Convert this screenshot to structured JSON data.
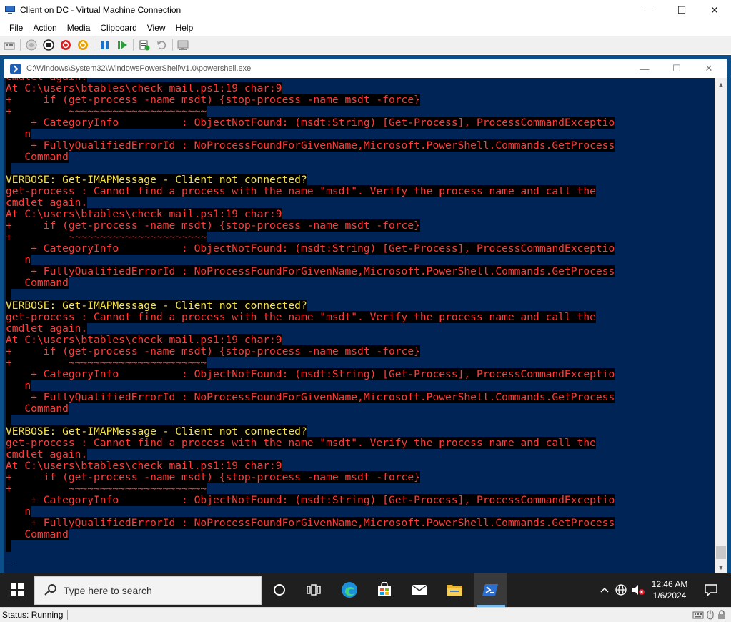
{
  "vm_window": {
    "title": "Client on DC - Virtual Machine Connection",
    "controls": {
      "minimize": "—",
      "maximize": "☐",
      "close": "✕"
    }
  },
  "menu": [
    "File",
    "Action",
    "Media",
    "Clipboard",
    "View",
    "Help"
  ],
  "toolbar": {
    "icons": [
      "ctrl-alt-del-icon",
      "start-icon",
      "turn-off-icon",
      "shut-down-icon",
      "save-icon",
      "pause-icon",
      "reset-icon",
      "checkpoint-icon",
      "revert-icon",
      "enhanced-session-icon"
    ],
    "colors": {
      "turn_off": "#d81e1e",
      "shut_down": "#e8a000",
      "pause": "#1a73c9",
      "reset": "#2e9e3a"
    }
  },
  "powershell": {
    "title": "C:\\Windows\\System32\\WindowsPowerShell\\v1.0\\powershell.exe",
    "background": "#012456",
    "lines": [
      {
        "type": "error",
        "text": "cmdlet again."
      },
      {
        "type": "error",
        "text": "At C:\\users\\btables\\check_mail.ps1:19 char:9"
      },
      {
        "type": "error",
        "text": "+     if (get-process -name msdt) {stop-process -name msdt -force}"
      },
      {
        "type": "error",
        "text": "+         ~~~~~~~~~~~~~~~~~~~~~~"
      },
      {
        "type": "error",
        "text": "    + CategoryInfo          : ObjectNotFound: (msdt:String) [Get-Process], ProcessCommandExceptio"
      },
      {
        "type": "error",
        "text": "   n"
      },
      {
        "type": "error",
        "text": "    + FullyQualifiedErrorId : NoProcessFoundForGivenName,Microsoft.PowerShell.Commands.GetProcess"
      },
      {
        "type": "error",
        "text": "   Command"
      },
      {
        "type": "blank",
        "text": ""
      },
      {
        "type": "verbose",
        "text": "VERBOSE: Get-IMAPMessage - Client not connected?"
      },
      {
        "type": "error",
        "text": "get-process : Cannot find a process with the name \"msdt\". Verify the process name and call the"
      },
      {
        "type": "error",
        "text": "cmdlet again."
      },
      {
        "type": "error",
        "text": "At C:\\users\\btables\\check_mail.ps1:19 char:9"
      },
      {
        "type": "error",
        "text": "+     if (get-process -name msdt) {stop-process -name msdt -force}"
      },
      {
        "type": "error",
        "text": "+         ~~~~~~~~~~~~~~~~~~~~~~"
      },
      {
        "type": "error",
        "text": "    + CategoryInfo          : ObjectNotFound: (msdt:String) [Get-Process], ProcessCommandExceptio"
      },
      {
        "type": "error",
        "text": "   n"
      },
      {
        "type": "error",
        "text": "    + FullyQualifiedErrorId : NoProcessFoundForGivenName,Microsoft.PowerShell.Commands.GetProcess"
      },
      {
        "type": "error",
        "text": "   Command"
      },
      {
        "type": "blank",
        "text": ""
      },
      {
        "type": "verbose",
        "text": "VERBOSE: Get-IMAPMessage - Client not connected?"
      },
      {
        "type": "error",
        "text": "get-process : Cannot find a process with the name \"msdt\". Verify the process name and call the"
      },
      {
        "type": "error",
        "text": "cmdlet again."
      },
      {
        "type": "error",
        "text": "At C:\\users\\btables\\check_mail.ps1:19 char:9"
      },
      {
        "type": "error",
        "text": "+     if (get-process -name msdt) {stop-process -name msdt -force}"
      },
      {
        "type": "error",
        "text": "+         ~~~~~~~~~~~~~~~~~~~~~~"
      },
      {
        "type": "error",
        "text": "    + CategoryInfo          : ObjectNotFound: (msdt:String) [Get-Process], ProcessCommandExceptio"
      },
      {
        "type": "error",
        "text": "   n"
      },
      {
        "type": "error",
        "text": "    + FullyQualifiedErrorId : NoProcessFoundForGivenName,Microsoft.PowerShell.Commands.GetProcess"
      },
      {
        "type": "error",
        "text": "   Command"
      },
      {
        "type": "blank",
        "text": ""
      },
      {
        "type": "verbose",
        "text": "VERBOSE: Get-IMAPMessage - Client not connected?"
      },
      {
        "type": "error",
        "text": "get-process : Cannot find a process with the name \"msdt\". Verify the process name and call the"
      },
      {
        "type": "error",
        "text": "cmdlet again."
      },
      {
        "type": "error",
        "text": "At C:\\users\\btables\\check_mail.ps1:19 char:9"
      },
      {
        "type": "error",
        "text": "+     if (get-process -name msdt) {stop-process -name msdt -force}"
      },
      {
        "type": "error",
        "text": "+         ~~~~~~~~~~~~~~~~~~~~~~"
      },
      {
        "type": "error",
        "text": "    + CategoryInfo          : ObjectNotFound: (msdt:String) [Get-Process], ProcessCommandExceptio"
      },
      {
        "type": "error",
        "text": "   n"
      },
      {
        "type": "error",
        "text": "    + FullyQualifiedErrorId : NoProcessFoundForGivenName,Microsoft.PowerShell.Commands.GetProcess"
      },
      {
        "type": "error",
        "text": "   Command"
      },
      {
        "type": "blank",
        "text": ""
      },
      {
        "type": "cursor",
        "text": "_"
      }
    ]
  },
  "taskbar": {
    "search_placeholder": "Type here to search",
    "apps": [
      "cortana-icon",
      "task-view-icon",
      "edge-icon",
      "store-icon",
      "mail-icon",
      "file-explorer-icon",
      "powershell-icon"
    ],
    "tray_icons": [
      "chevron-up-icon",
      "network-icon",
      "volume-muted-icon"
    ],
    "time": "12:46 AM",
    "date": "1/6/2024",
    "notification_icon": "action-center-icon"
  },
  "statusbar": {
    "status": "Status: Running"
  }
}
